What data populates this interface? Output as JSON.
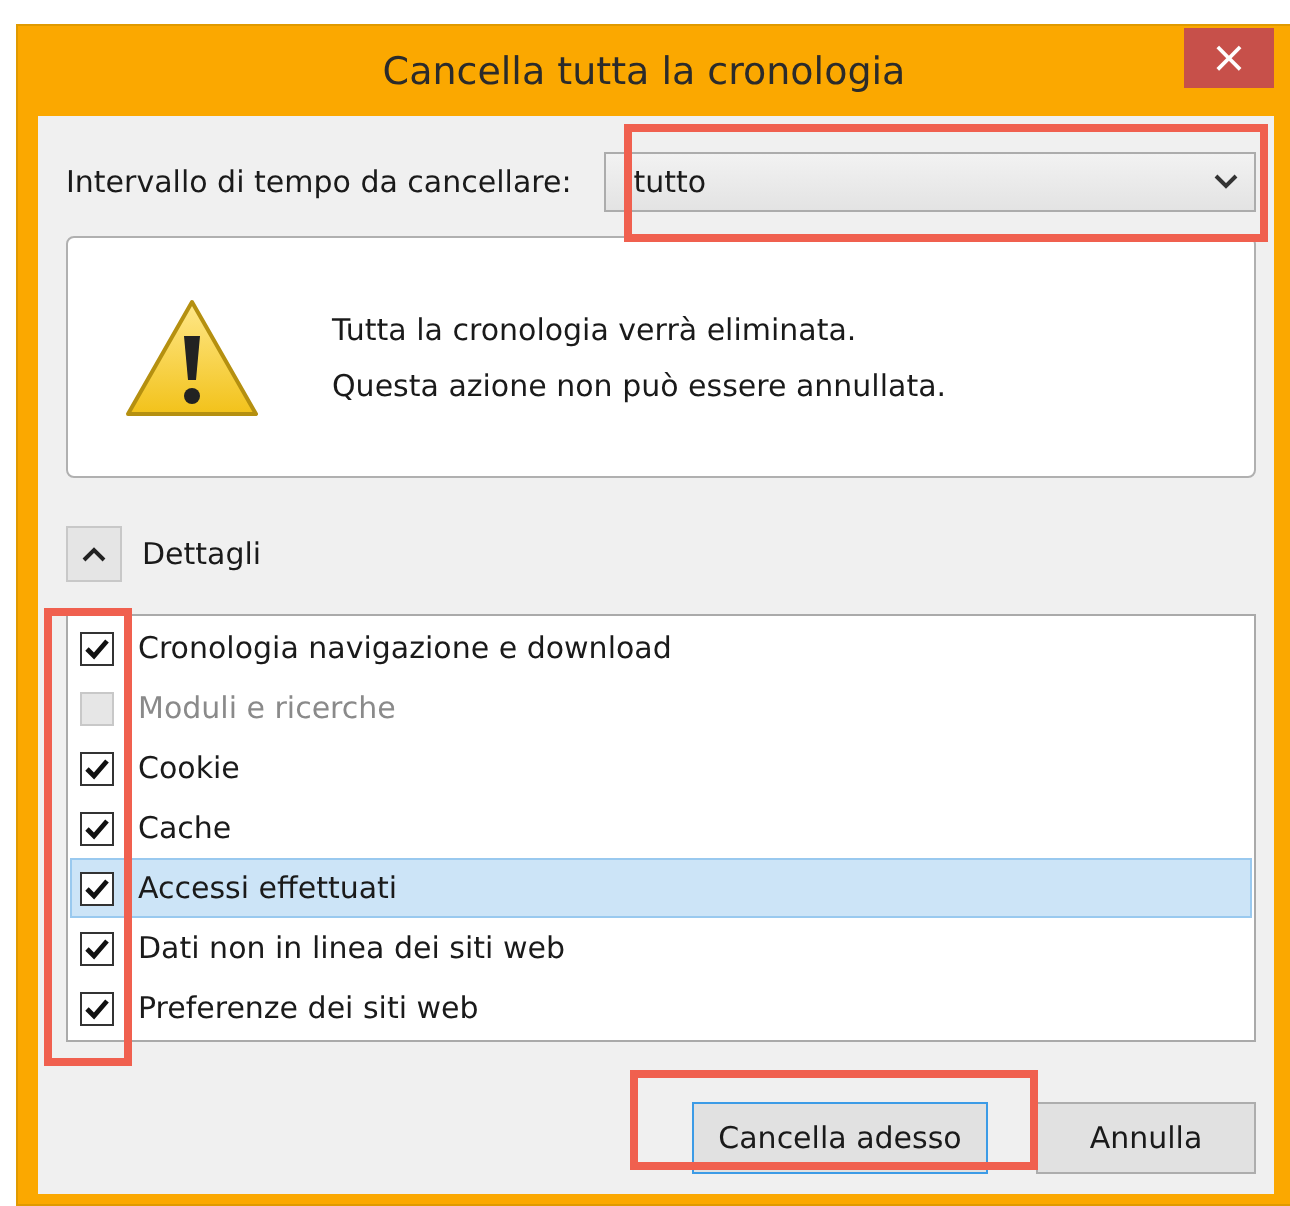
{
  "window": {
    "title": "Cancella tutta la cronologia",
    "close": "×"
  },
  "range": {
    "label": "Intervallo di tempo da cancellare:",
    "value": "tutto"
  },
  "warning": {
    "lines": [
      "Tutta la cronologia verrà eliminata.",
      "Questa azione non può essere annullata."
    ]
  },
  "details": {
    "label": "Dettagli",
    "expanded": true
  },
  "items": [
    {
      "label": "Cronologia navigazione e download",
      "checked": true,
      "disabled": false,
      "selected": false
    },
    {
      "label": "Moduli e ricerche",
      "checked": false,
      "disabled": true,
      "selected": false
    },
    {
      "label": "Cookie",
      "checked": true,
      "disabled": false,
      "selected": false
    },
    {
      "label": "Cache",
      "checked": true,
      "disabled": false,
      "selected": false
    },
    {
      "label": "Accessi effettuati",
      "checked": true,
      "disabled": false,
      "selected": true
    },
    {
      "label": "Dati non in linea dei siti web",
      "checked": true,
      "disabled": false,
      "selected": false
    },
    {
      "label": "Preferenze dei siti web",
      "checked": true,
      "disabled": false,
      "selected": false
    }
  ],
  "buttons": [
    {
      "label": "Cancella adesso",
      "kind": "default"
    },
    {
      "label": "Annulla",
      "kind": "normal"
    }
  ]
}
